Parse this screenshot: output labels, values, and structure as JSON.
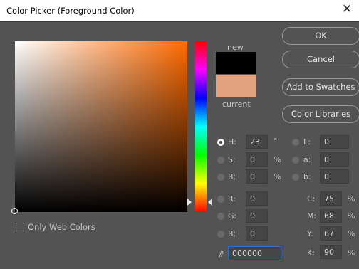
{
  "window": {
    "title": "Color Picker (Foreground Color)",
    "close_glyph": "✕"
  },
  "colors": {
    "new_color": "#000000",
    "current_color": "#e3a27f",
    "field_hue": "#ff6a00"
  },
  "swatch": {
    "new_label": "new",
    "current_label": "current"
  },
  "buttons": {
    "ok": "OK",
    "cancel": "Cancel",
    "add_to_swatches": "Add to Swatches",
    "color_libraries": "Color Libraries"
  },
  "hsb": {
    "h": {
      "label": "H:",
      "value": "23",
      "unit": "°",
      "selected": true
    },
    "s": {
      "label": "S:",
      "value": "0",
      "unit": "%"
    },
    "b": {
      "label": "B:",
      "value": "0",
      "unit": "%"
    }
  },
  "lab": {
    "l": {
      "label": "L:",
      "value": "0"
    },
    "a": {
      "label": "a:",
      "value": "0"
    },
    "b": {
      "label": "b:",
      "value": "0"
    }
  },
  "rgb": {
    "r": {
      "label": "R:",
      "value": "0"
    },
    "g": {
      "label": "G:",
      "value": "0"
    },
    "b": {
      "label": "B:",
      "value": "0"
    }
  },
  "cmyk": {
    "c": {
      "label": "C:",
      "value": "75",
      "unit": "%"
    },
    "m": {
      "label": "M:",
      "value": "68",
      "unit": "%"
    },
    "y": {
      "label": "Y:",
      "value": "67",
      "unit": "%"
    },
    "k": {
      "label": "K:",
      "value": "90",
      "unit": "%"
    }
  },
  "hex": {
    "label": "#",
    "value": "000000"
  },
  "only_web_colors": {
    "label": "Only Web Colors",
    "checked": false
  }
}
